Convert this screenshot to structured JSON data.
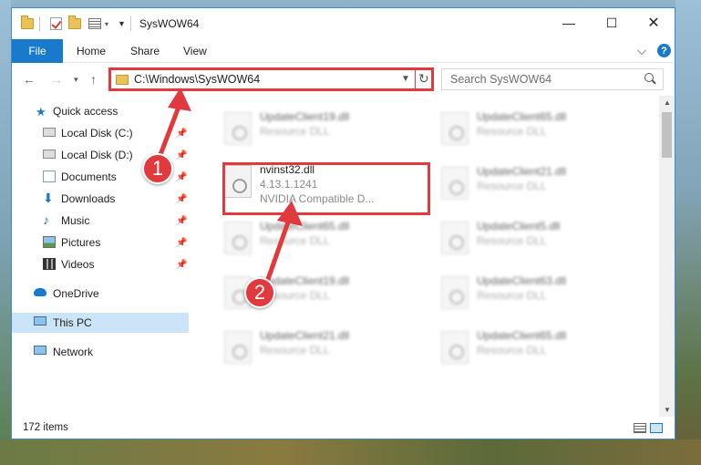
{
  "window": {
    "title": "SysWOW64"
  },
  "ribbon": {
    "tabs": [
      "File",
      "Home",
      "Share",
      "View"
    ],
    "help_label": "?"
  },
  "nav": {
    "address": "C:\\Windows\\SysWOW64",
    "search_placeholder": "Search SysWOW64"
  },
  "sidebar": {
    "items": [
      {
        "label": "Quick access",
        "icon": "star-icon"
      },
      {
        "label": "Local Disk (C:)",
        "icon": "drive-icon",
        "pinned": true
      },
      {
        "label": "Local Disk (D:)",
        "icon": "drive-icon",
        "pinned": true
      },
      {
        "label": "Documents",
        "icon": "documents-icon",
        "pinned": true
      },
      {
        "label": "Downloads",
        "icon": "downloads-icon",
        "pinned": true
      },
      {
        "label": "Music",
        "icon": "music-icon",
        "pinned": true
      },
      {
        "label": "Pictures",
        "icon": "pictures-icon",
        "pinned": true
      },
      {
        "label": "Videos",
        "icon": "videos-icon",
        "pinned": true
      },
      {
        "label": "OneDrive",
        "icon": "cloud-icon"
      },
      {
        "label": "This PC",
        "icon": "computer-icon",
        "selected": true
      },
      {
        "label": "Network",
        "icon": "network-icon"
      }
    ]
  },
  "files": [
    {
      "name": "UpdateClient19.dll",
      "line1": "Resource DLL",
      "blurred": true
    },
    {
      "name": "UpdateClient65.dll",
      "line1": "Resource DLL",
      "blurred": true
    },
    {
      "name": "nvinst32.dll",
      "line1": "4.13.1.1241",
      "line2": "NVIDIA Compatible D...",
      "blurred": false
    },
    {
      "name": "UpdateClient21.dll",
      "line1": "Resource DLL",
      "blurred": true
    },
    {
      "name": "UpdateClient65.dll",
      "line1": "Resource DLL",
      "blurred": true
    },
    {
      "name": "UpdateClient5.dll",
      "line1": "Resource DLL",
      "blurred": true
    },
    {
      "name": "UpdateClient19.dll",
      "line1": "Resource DLL",
      "blurred": true
    },
    {
      "name": "UpdateClient63.dll",
      "line1": "Resource DLL",
      "blurred": true
    },
    {
      "name": "UpdateClient21.dll",
      "line1": "Resource DLL",
      "blurred": true
    },
    {
      "name": "UpdateClient65.dll",
      "line1": "Resource DLL",
      "blurred": true
    }
  ],
  "status": {
    "item_count": "172 items"
  },
  "callouts": [
    "1",
    "2"
  ],
  "colors": {
    "accent": "#1979ca",
    "highlight": "#e03a3e",
    "selected": "#cce4f7"
  }
}
